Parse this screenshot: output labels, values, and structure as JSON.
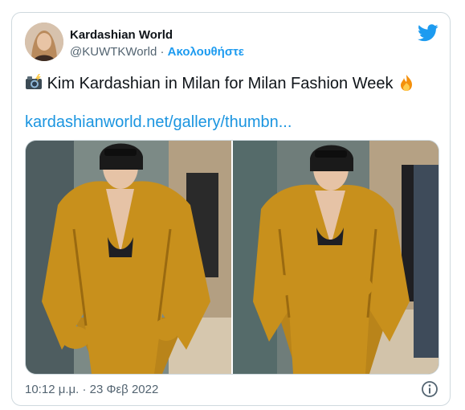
{
  "author": {
    "name": "Kardashian World",
    "handle": "@KUWTKWorld",
    "separator": "·",
    "follow_label": "Ακολουθήστε"
  },
  "tweet": {
    "text": "Kim Kardashian in Milan for Milan Fashion Week",
    "leading_emoji": "camera-with-flash-icon",
    "trailing_emoji": "fire-icon",
    "link": "kardashianworld.net/gallery/thumbn..."
  },
  "media": {
    "photos": [
      {
        "label": "photo-left"
      },
      {
        "label": "photo-right"
      }
    ]
  },
  "footer": {
    "timestamp": "10:12 μ.μ. · 23 Φεβ 2022"
  },
  "colors": {
    "accent": "#1d9bf0",
    "link": "#1b95e0",
    "text": "#0f1419",
    "secondary": "#536471",
    "jacket": "#c8901c"
  }
}
